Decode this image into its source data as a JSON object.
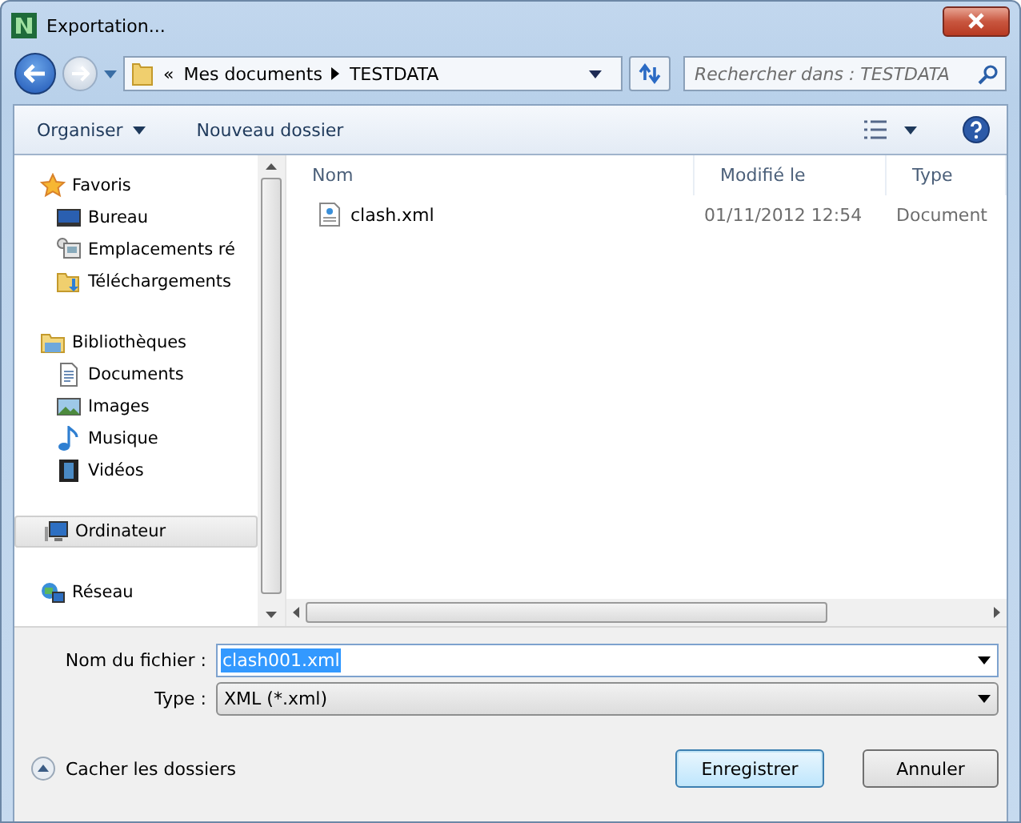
{
  "window": {
    "title": "Exportation..."
  },
  "address_bar": {
    "overflow": "«",
    "path": [
      "Mes documents",
      "TESTDATA"
    ]
  },
  "search": {
    "placeholder": "Rechercher dans : TESTDATA"
  },
  "toolbar": {
    "organize": "Organiser",
    "new_folder": "Nouveau dossier"
  },
  "sidebar": {
    "groups": [
      {
        "label": "Favoris",
        "kind": "star",
        "selected": false,
        "children": [
          {
            "label": "Bureau",
            "kind": "desktop",
            "selected": false
          },
          {
            "label": "Emplacements ré",
            "kind": "places",
            "selected": false
          },
          {
            "label": "Téléchargements",
            "kind": "downloads",
            "selected": false
          }
        ]
      },
      {
        "label": "Bibliothèques",
        "kind": "library",
        "selected": false,
        "children": [
          {
            "label": "Documents",
            "kind": "document",
            "selected": false
          },
          {
            "label": "Images",
            "kind": "images",
            "selected": false
          },
          {
            "label": "Musique",
            "kind": "music",
            "selected": false
          },
          {
            "label": "Vidéos",
            "kind": "video",
            "selected": false
          }
        ]
      },
      {
        "label": "Ordinateur",
        "kind": "computer",
        "selected": true
      },
      {
        "label": "Réseau",
        "kind": "network",
        "selected": false
      }
    ]
  },
  "table": {
    "columns": [
      "Nom",
      "Modifié le",
      "Type"
    ],
    "rows": [
      {
        "name": "clash.xml",
        "modified": "01/11/2012 12:54",
        "type": "Document",
        "selected": false
      }
    ]
  },
  "fields": {
    "filename": {
      "label": "Nom du fichier :",
      "value": "clash001.xml"
    },
    "type": {
      "label": "Type :",
      "value": "XML (*.xml)"
    }
  },
  "hide_folders": "Cacher les dossiers",
  "buttons": [
    {
      "label": "Enregistrer",
      "default": true
    },
    {
      "label": "Annuler",
      "default": false
    }
  ]
}
